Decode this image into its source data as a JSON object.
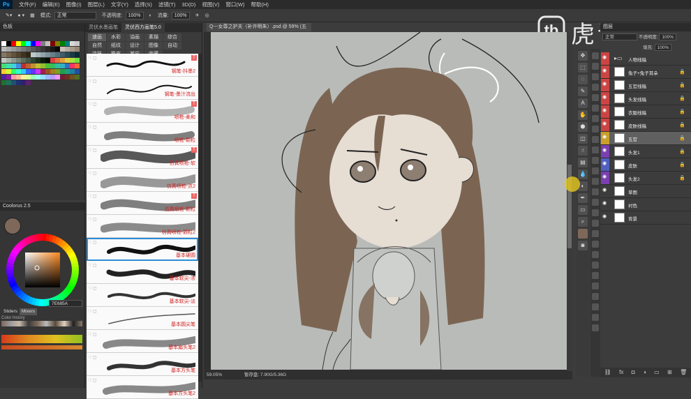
{
  "menu": {
    "logo": "Ps",
    "items": [
      "文件(F)",
      "编辑(E)",
      "图像(I)",
      "图层(L)",
      "文字(Y)",
      "选择(S)",
      "滤镜(T)",
      "3D(D)",
      "视图(V)",
      "窗口(W)",
      "帮助(H)"
    ]
  },
  "options": {
    "mode_label": "模式:",
    "mode_value": "正常",
    "opacity_label": "不透明度:",
    "opacity_value": "100%",
    "flow_label": "流量:",
    "flow_value": "100%"
  },
  "brand": {
    "text": "虎课网"
  },
  "swatches": {
    "title": "色板",
    "colors": [
      "#ffffff",
      "#000000",
      "#ff0000",
      "#ffff00",
      "#00ff00",
      "#00ffff",
      "#0000ff",
      "#ff00ff",
      "#808080",
      "#c0c0c0",
      "#800000",
      "#808000",
      "#008000",
      "#008080",
      "#d8d8d8",
      "#c8c8c8",
      "#b8b8b8",
      "#a8a8a8",
      "#989898",
      "#888888",
      "#787878",
      "#686868",
      "#585858",
      "#484848",
      "#383838",
      "#282828",
      "#181818",
      "#080808",
      "#c9c0b8",
      "#b8ada2",
      "#a79a8d",
      "#968877",
      "#857662",
      "#74644e",
      "#63533c",
      "#52432d",
      "#41341f",
      "#302613",
      "#bfc8cc",
      "#a9b6bc",
      "#93a4ab",
      "#7d929b",
      "#68808a",
      "#536e79",
      "#3f5c68",
      "#2c4a57",
      "#1b3946",
      "#0c2935",
      "#c1c7c2",
      "#a7b0a8",
      "#8e998f",
      "#758376",
      "#5d6d5e",
      "#465847",
      "#2f4331",
      "#1a2f1c",
      "#0a1c0c",
      "#030c04",
      "#e04040",
      "#e07040",
      "#e0a040",
      "#e0d040",
      "#b0e040",
      "#70e040",
      "#40e070",
      "#40e0b0",
      "#40d0e0",
      "#4090e0",
      "#c03030",
      "#c06030",
      "#c09030",
      "#c0c030",
      "#90c030",
      "#50c030",
      "#30c060",
      "#30c0a0",
      "#30b0c0",
      "#3070c0",
      "#ff3366",
      "#ff6633",
      "#ffcc33",
      "#ccff33",
      "#33ff66",
      "#33ffcc",
      "#33ccff",
      "#3366ff",
      "#6633ff",
      "#cc33ff",
      "#a02050",
      "#a05020",
      "#a08020",
      "#80a020",
      "#20a050",
      "#20a080",
      "#2080a0",
      "#2050a0",
      "#5020a0",
      "#8020a0",
      "#ff99aa",
      "#ffbb99",
      "#ffee99",
      "#ddff99",
      "#99ffbb",
      "#99ffee",
      "#99ddff",
      "#99bbff",
      "#bb99ff",
      "#ee99ff",
      "#702030",
      "#703020",
      "#705020",
      "#507020",
      "#207030",
      "#207060",
      "#205070",
      "#203070",
      "#302070",
      "#602070"
    ]
  },
  "coolorus": {
    "title": "Coolorus 2.5",
    "hex_value": "7E685A",
    "tabs": [
      "Sliders",
      "Mixers"
    ],
    "history_label": "Color history"
  },
  "brush_panel": {
    "tabs": [
      "灵伏水墨画笔",
      "灵伏西方画笔5.0"
    ],
    "categories": [
      "速画",
      "水彩",
      "油画",
      "素描",
      "综合",
      "自然",
      "纸纹",
      "设计",
      "图像",
      "自动",
      "涂抹",
      "橡皮",
      "其它",
      "收藏"
    ],
    "brushes": [
      {
        "name": "钢笔-抖墨2"
      },
      {
        "name": "钢笔-墨汁流出"
      },
      {
        "name": "喷枪-柔和"
      },
      {
        "name": "喷枪-颗粒"
      },
      {
        "name": "仿真喷枪-软"
      },
      {
        "name": "仿真喷枪-点2"
      },
      {
        "name": "仿真喷枪-颗粒"
      },
      {
        "name": "仿真喷枪-颗粒2"
      },
      {
        "name": "基本硬圆"
      },
      {
        "name": "基本软尖-浓"
      },
      {
        "name": "基本软尖-淡"
      },
      {
        "name": "基本圆尖笔"
      },
      {
        "name": "基本扁头笔2"
      },
      {
        "name": "基本方头笔"
      },
      {
        "name": "基本方头笔2"
      }
    ],
    "selected_index": 8
  },
  "document": {
    "tab_title": "Q---女尊之护夫（补许明朱）.psd @ 59% (五官, RGB/8) *",
    "zoom": "59.05%",
    "doc_size": "暂存盘: 7.90G/5.36G"
  },
  "layers": {
    "title": "图层",
    "blend_mode": "正常",
    "opacity_label": "不透明度:",
    "opacity_value": "100%",
    "fill_label": "填充:",
    "fill_value": "100%",
    "items": [
      {
        "name": "人物线稿",
        "group": true,
        "color": "#c44"
      },
      {
        "name": "兔子+兔子耳朵",
        "color": "#c44"
      },
      {
        "name": "五官线稿",
        "color": "#c44"
      },
      {
        "name": "头发线稿",
        "color": "#c44"
      },
      {
        "name": "衣服线稿",
        "color": "#c44"
      },
      {
        "name": "皮肤线稿",
        "color": "#c44"
      },
      {
        "name": "五官",
        "color": "#c9a02a",
        "selected": true
      },
      {
        "name": "头发1",
        "color": "#7a3fb0"
      },
      {
        "name": "皮肤",
        "color": "#5060c0"
      },
      {
        "name": "头发2",
        "color": "#7a3fb0"
      },
      {
        "name": "草图",
        "color": ""
      },
      {
        "name": "衬色",
        "color": ""
      },
      {
        "name": "背景",
        "color": ""
      }
    ]
  }
}
